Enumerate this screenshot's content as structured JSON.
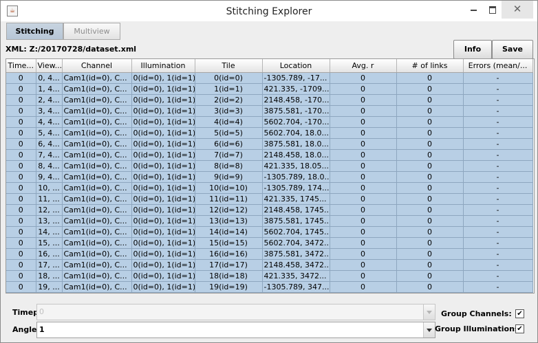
{
  "window": {
    "title": "Stitching Explorer",
    "close_glyph": "✕",
    "app_icon": "java-icon"
  },
  "tabs": [
    {
      "label": "Stitching",
      "selected": true
    },
    {
      "label": "Multiview",
      "selected": false
    }
  ],
  "xml_label": "XML: Z:/20170728/dataset.xml",
  "buttons": {
    "info": "Info",
    "save": "Save"
  },
  "table": {
    "columns": [
      "Time...",
      "View...",
      "Channel",
      "Illumination",
      "Tile",
      "Location",
      "Avg. r",
      "# of links",
      "Errors (mean/..."
    ],
    "rows": [
      [
        "0",
        "0, 4...",
        "Cam1(id=0), C...",
        "0(id=0), 1(id=1)",
        "0(id=0)",
        "-1305.789, -17...",
        "0",
        "0",
        "-"
      ],
      [
        "0",
        "1, 4...",
        "Cam1(id=0), C...",
        "0(id=0), 1(id=1)",
        "1(id=1)",
        "421.335, -1709...",
        "0",
        "0",
        "-"
      ],
      [
        "0",
        "2, 4...",
        "Cam1(id=0), C...",
        "0(id=0), 1(id=1)",
        "2(id=2)",
        "2148.458, -170...",
        "0",
        "0",
        "-"
      ],
      [
        "0",
        "3, 4...",
        "Cam1(id=0), C...",
        "0(id=0), 1(id=1)",
        "3(id=3)",
        "3875.581, -170...",
        "0",
        "0",
        "-"
      ],
      [
        "0",
        "4, 4...",
        "Cam1(id=0), C...",
        "0(id=0), 1(id=1)",
        "4(id=4)",
        "5602.704, -170...",
        "0",
        "0",
        "-"
      ],
      [
        "0",
        "5, 4...",
        "Cam1(id=0), C...",
        "0(id=0), 1(id=1)",
        "5(id=5)",
        "5602.704, 18.0...",
        "0",
        "0",
        "-"
      ],
      [
        "0",
        "6, 4...",
        "Cam1(id=0), C...",
        "0(id=0), 1(id=1)",
        "6(id=6)",
        "3875.581, 18.0...",
        "0",
        "0",
        "-"
      ],
      [
        "0",
        "7, 4...",
        "Cam1(id=0), C...",
        "0(id=0), 1(id=1)",
        "7(id=7)",
        "2148.458, 18.0...",
        "0",
        "0",
        "-"
      ],
      [
        "0",
        "8, 4...",
        "Cam1(id=0), C...",
        "0(id=0), 1(id=1)",
        "8(id=8)",
        "421.335, 18.05...",
        "0",
        "0",
        "-"
      ],
      [
        "0",
        "9, 4...",
        "Cam1(id=0), C...",
        "0(id=0), 1(id=1)",
        "9(id=9)",
        "-1305.789, 18.0...",
        "0",
        "0",
        "-"
      ],
      [
        "0",
        "10, ...",
        "Cam1(id=0), C...",
        "0(id=0), 1(id=1)",
        "10(id=10)",
        "-1305.789, 174...",
        "0",
        "0",
        "-"
      ],
      [
        "0",
        "11, ...",
        "Cam1(id=0), C...",
        "0(id=0), 1(id=1)",
        "11(id=11)",
        "421.335, 1745...",
        "0",
        "0",
        "-"
      ],
      [
        "0",
        "12, ...",
        "Cam1(id=0), C...",
        "0(id=0), 1(id=1)",
        "12(id=12)",
        "2148.458, 1745...",
        "0",
        "0",
        "-"
      ],
      [
        "0",
        "13, ...",
        "Cam1(id=0), C...",
        "0(id=0), 1(id=1)",
        "13(id=13)",
        "3875.581, 1745...",
        "0",
        "0",
        "-"
      ],
      [
        "0",
        "14, ...",
        "Cam1(id=0), C...",
        "0(id=0), 1(id=1)",
        "14(id=14)",
        "5602.704, 1745...",
        "0",
        "0",
        "-"
      ],
      [
        "0",
        "15, ...",
        "Cam1(id=0), C...",
        "0(id=0), 1(id=1)",
        "15(id=15)",
        "5602.704, 3472...",
        "0",
        "0",
        "-"
      ],
      [
        "0",
        "16, ...",
        "Cam1(id=0), C...",
        "0(id=0), 1(id=1)",
        "16(id=16)",
        "3875.581, 3472...",
        "0",
        "0",
        "-"
      ],
      [
        "0",
        "17, ...",
        "Cam1(id=0), C...",
        "0(id=0), 1(id=1)",
        "17(id=17)",
        "2148.458, 3472...",
        "0",
        "0",
        "-"
      ],
      [
        "0",
        "18, ...",
        "Cam1(id=0), C...",
        "0(id=0), 1(id=1)",
        "18(id=18)",
        "421.335, 3472...",
        "0",
        "0",
        "-"
      ],
      [
        "0",
        "19, ...",
        "Cam1(id=0), C...",
        "0(id=0), 1(id=1)",
        "19(id=19)",
        "-1305.789, 347...",
        "0",
        "0",
        "-"
      ]
    ]
  },
  "controls": {
    "timepoint": {
      "label": "Timepoint:",
      "value": "0",
      "enabled": false
    },
    "angle": {
      "label": "Angle:",
      "value": "1"
    },
    "group_channels": {
      "label": "Group Channels:",
      "checked": true
    },
    "group_illuminations": {
      "label": "Group Illuminations:",
      "checked": true
    },
    "check_glyph": "✔"
  },
  "colors": {
    "row_selected": "#b8cfe5",
    "tab_selected": "#c0cedc"
  }
}
